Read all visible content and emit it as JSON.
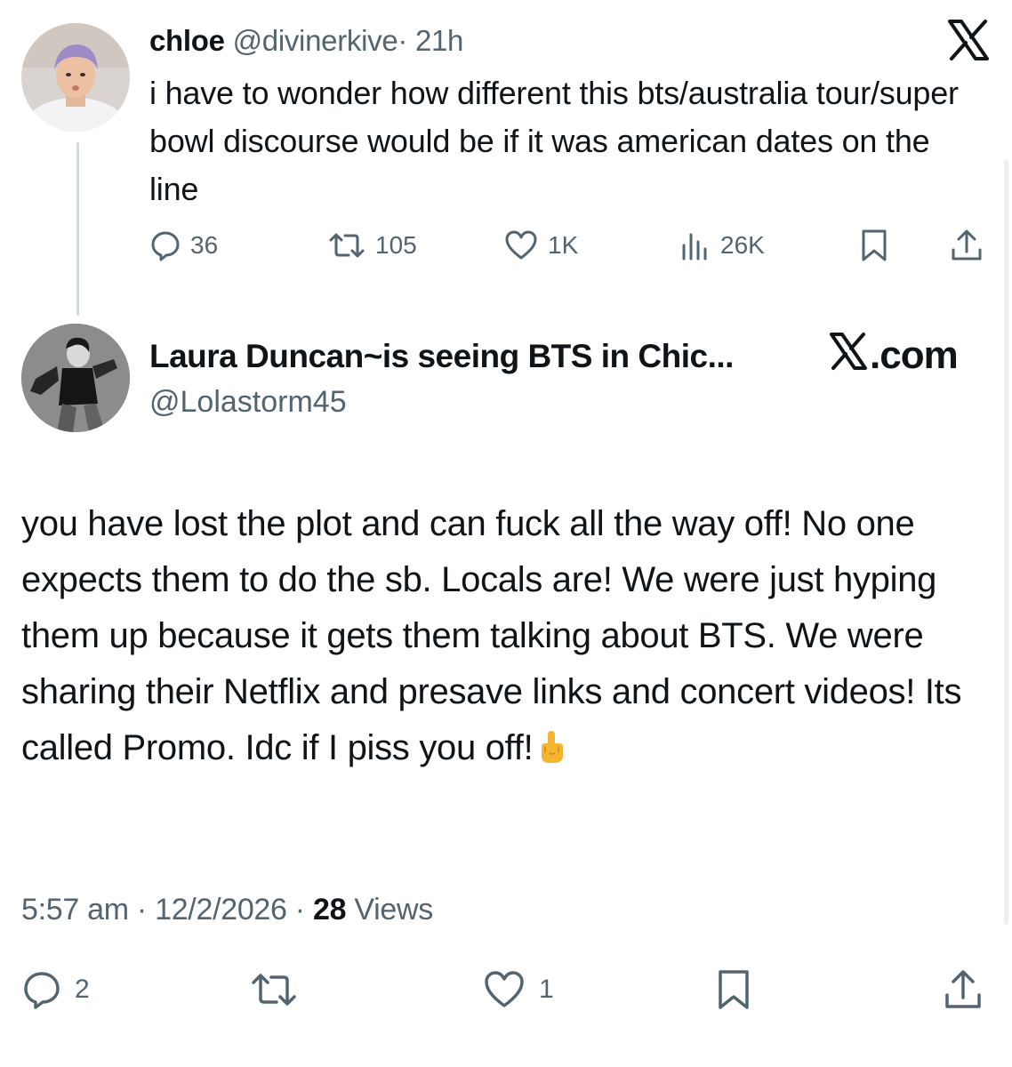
{
  "quoted_tweet": {
    "author_name": "chloe",
    "handle": "@divinerkive",
    "separator": "·",
    "time": "21h",
    "text": "i have to wonder how different this bts/australia tour/super bowl discourse would be if it was american dates on the line",
    "actions": {
      "replies": "36",
      "reposts": "105",
      "likes": "1K",
      "views": "26K"
    },
    "icons": [
      "x-logo-icon",
      "reply-icon",
      "repost-icon",
      "like-icon",
      "views-icon",
      "bookmark-icon",
      "share-icon"
    ]
  },
  "reply_tweet": {
    "author_name": "Laura Duncan~is seeing BTS in Chic...",
    "handle": "@Lolastorm45",
    "brand": ".com",
    "text": "you have lost the plot and can fuck all the way off! No one expects them to do the sb. Locals are! We were just hyping them up because it gets them talking about BTS. We were sharing their Netflix and presave links and concert videos! Its called Promo. Idc if I piss you off!",
    "emoji": "middle-finger-emoji",
    "meta": {
      "time": "5:57 am",
      "sep1": " · ",
      "date": "12/2/2026",
      "sep2": " · ",
      "views_count": "28",
      "views_label": " Views"
    },
    "actions": {
      "replies": "2",
      "likes": "1"
    },
    "icons": [
      "reply-icon",
      "repost-icon",
      "like-icon",
      "bookmark-icon",
      "share-icon"
    ]
  },
  "colors": {
    "text_primary": "#0f1419",
    "text_secondary": "#536471",
    "thread_line": "#cfd9de",
    "background": "#ffffff"
  }
}
